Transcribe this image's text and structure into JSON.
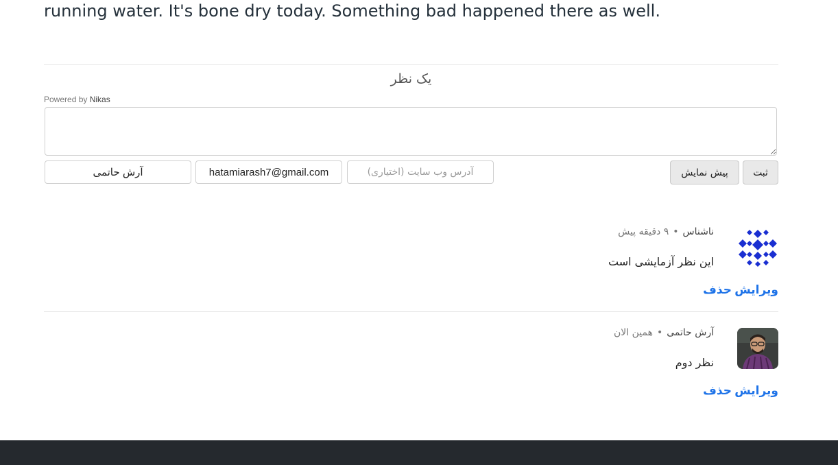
{
  "article": {
    "trailing_text": "running water. It's bone dry today. Something bad happened there as well."
  },
  "comments_section": {
    "count_label": "یک نظر",
    "powered_by_prefix": "Powered by",
    "powered_by_brand": "Nikas",
    "form": {
      "textarea_value": "",
      "name_value": "آرش حاتمی",
      "email_value": "hatamiarash7@gmail.com",
      "website_placeholder": "آدرس وب سایت (اختیاری)",
      "preview_label": "پیش نمایش",
      "submit_label": "ثبت"
    },
    "comments": [
      {
        "author": "ناشناس",
        "time": "۹ دقیقه پیش",
        "text": "این نظر آزمایشی است",
        "avatar_icon": "identicon-icon",
        "edit_label": "ویرایش",
        "delete_label": "حذف"
      },
      {
        "author": "آرش حاتمی",
        "time": "همین الان",
        "text": "نظر دوم",
        "avatar_icon": "user-photo-avatar",
        "edit_label": "ویرایش",
        "delete_label": "حذف"
      }
    ],
    "separator": "•"
  },
  "colors": {
    "link_blue": "#1e73e8",
    "identicon_blue": "#1a2fd1",
    "footer_bg": "#25292e"
  }
}
